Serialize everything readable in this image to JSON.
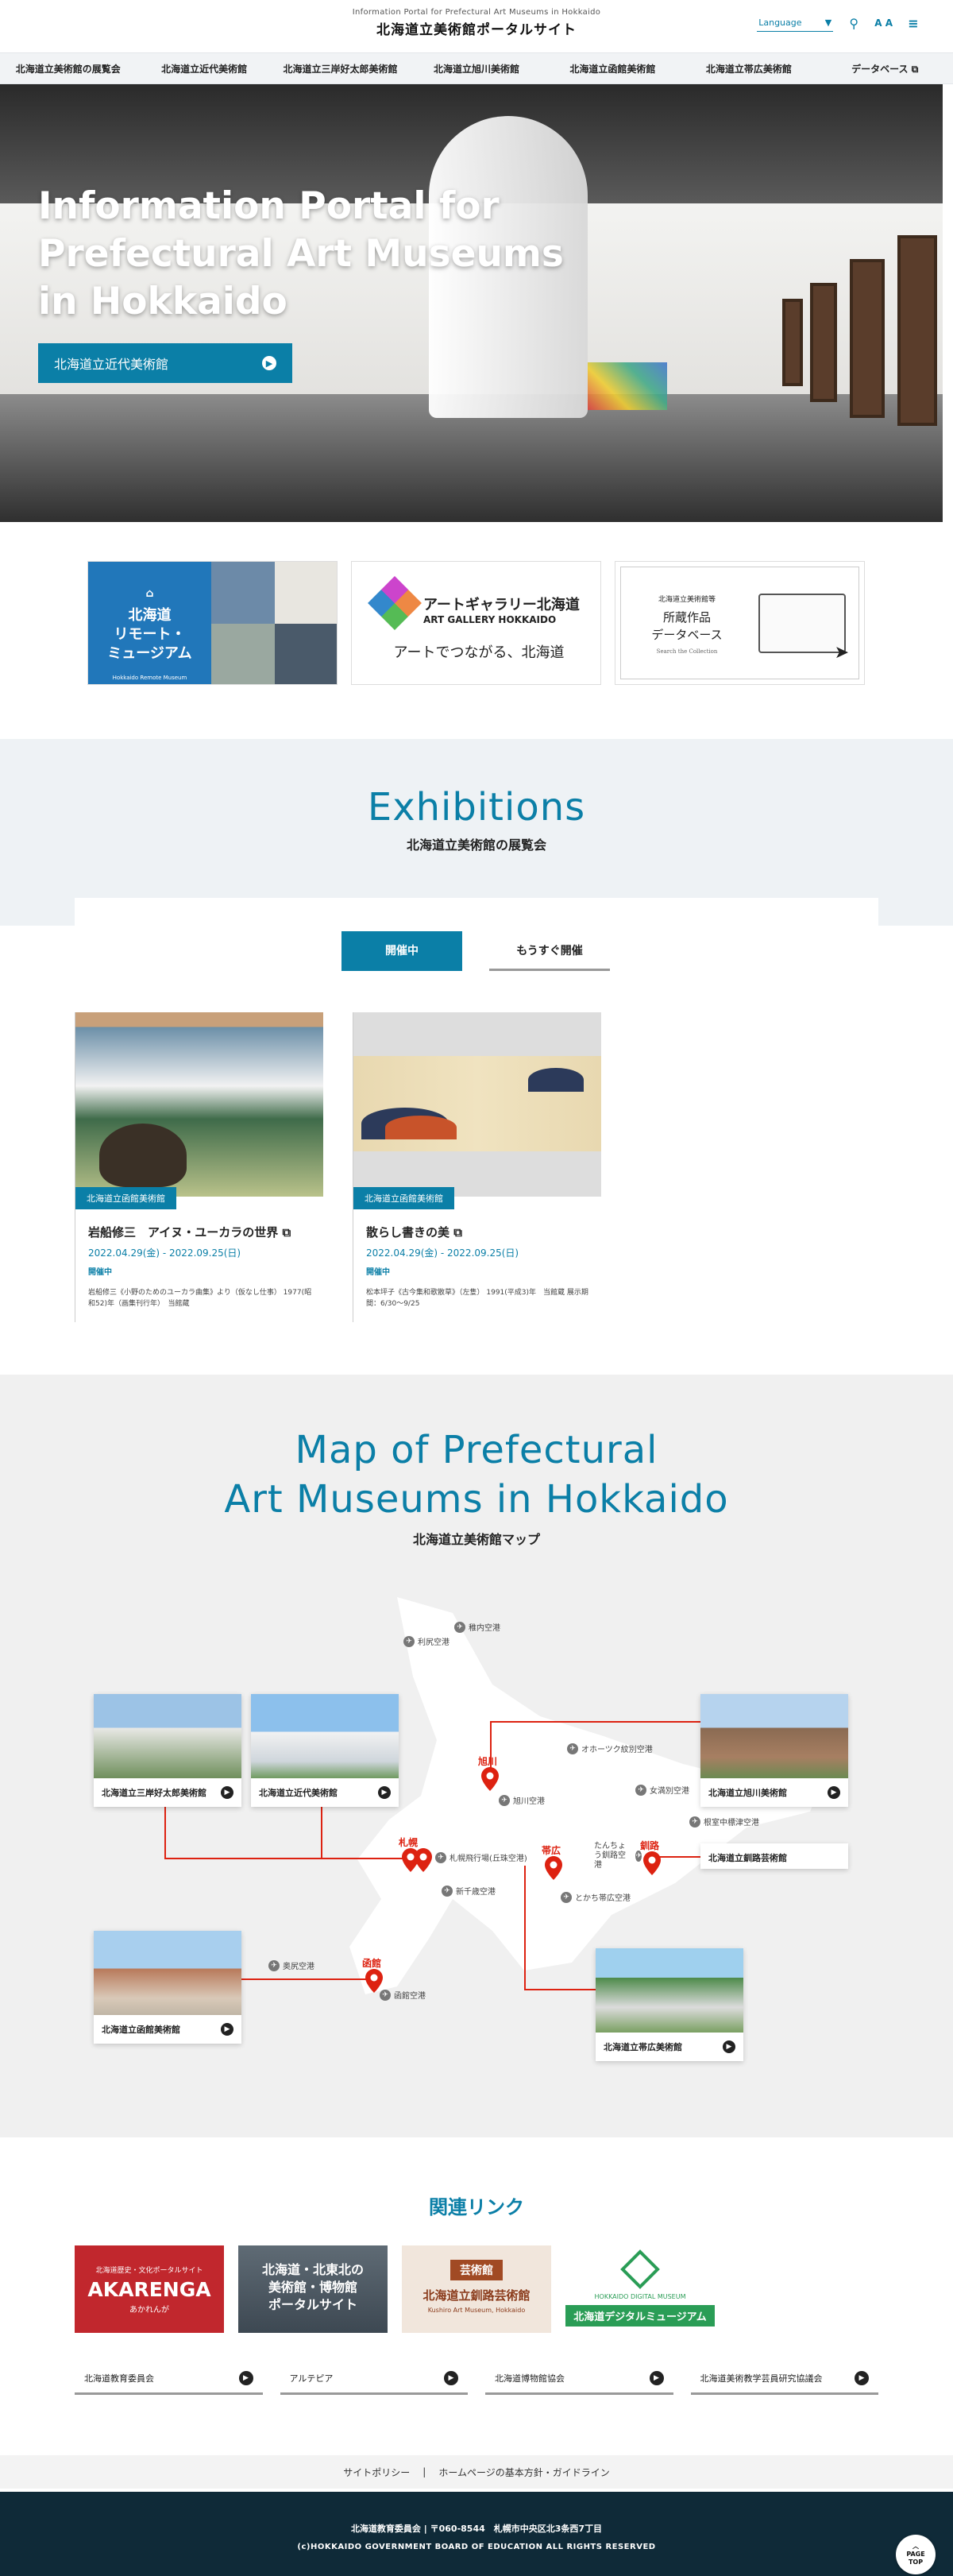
{
  "header": {
    "subtitle_en": "Information Portal for Prefectural Art Museums in Hokkaido",
    "title_ja": "北海道立美術館ポータルサイト",
    "language_label": "Language",
    "search_icon": "search-icon",
    "font_size_label": "A A"
  },
  "nav": [
    {
      "label": "北海道立美術館の展覧会"
    },
    {
      "label": "北海道立近代美術館"
    },
    {
      "label": "北海道立三岸好太郎美術館"
    },
    {
      "label": "北海道立旭川美術館"
    },
    {
      "label": "北海道立函館美術館"
    },
    {
      "label": "北海道立帯広美術館"
    },
    {
      "label": "データベース ⧉"
    }
  ],
  "hero": {
    "title_line1": "Information Portal for",
    "title_line2": "Prefectural Art Museums",
    "title_line3": "in Hokkaido",
    "cta_label": "北海道立近代美術館"
  },
  "banners": {
    "remote": {
      "title_line1": "北海道",
      "title_line2": "リモート・",
      "title_line3": "ミュージアム",
      "sub": "Hokkaido Remote Museum"
    },
    "gallery": {
      "title": "アートギャラリー北海道",
      "title_en": "ART GALLERY HOKKAIDO",
      "tagline": "アートでつながる、北海道"
    },
    "database": {
      "line1": "北海道立美術館等",
      "line2": "所蔵作品",
      "line3": "データベース",
      "line4": "Search the Collection"
    }
  },
  "exhibitions": {
    "title_en": "Exhibitions",
    "title_ja": "北海道立美術館の展覧会",
    "tab_current": "開催中",
    "tab_upcoming": "もうすぐ開催",
    "cards": [
      {
        "museum": "北海道立函館美術館",
        "title": "岩船修三　アイヌ・ユーカラの世界 ⧉",
        "date": "2022.04.29(金) - 2022.09.25(日)",
        "status": "開催中",
        "caption": "岩船修三《小野のためのユーカラ曲集》より（仮なし仕事） 1977(昭和52)年（画集刊行年）　当館蔵"
      },
      {
        "museum": "北海道立函館美術館",
        "title": "散らし書きの美 ⧉",
        "date": "2022.04.29(金) - 2022.09.25(日)",
        "status": "開催中",
        "caption": "松本坪子《古今集和歌散草》（左隻） 1991(平成3)年　当館蔵 展示期間：6/30〜9/25"
      }
    ]
  },
  "map": {
    "title_en_line1": "Map of Prefectural",
    "title_en_line2": "Art Museums in Hokkaido",
    "title_ja": "北海道立美術館マップ",
    "cities": {
      "sapporo": "札幌",
      "asahikawa": "旭川",
      "hakodate": "函館",
      "obihiro": "帯広",
      "kushiro": "釧路"
    },
    "airports": {
      "wakkanai": "稚内空港",
      "rishiri": "利尻空港",
      "okhotsk": "オホーツク紋別空港",
      "asahikawa": "旭川空港",
      "memanbetsu": "女満別空港",
      "nakashibetsu": "根室中標津空港",
      "okadama": "札幌飛行場(丘珠空港)",
      "chitose": "新千歳空港",
      "tokachi": "とかち帯広空港",
      "kushiro": "たんちょう釧路空港",
      "okushiri": "奥尻空港",
      "hakodate": "函館空港"
    },
    "museums": {
      "migishi": "北海道立三岸好太郎美術館",
      "modern": "北海道立近代美術館",
      "asahikawa": "北海道立旭川美術館",
      "kushiro": "北海道立釧路芸術館",
      "hakodate": "北海道立函館美術館",
      "obihiro": "北海道立帯広美術館"
    }
  },
  "related": {
    "title": "関連リンク",
    "akarenga": {
      "sub": "北海道歴史・文化ポータルサイト",
      "main": "AKARENGA",
      "kana": "あかれんが"
    },
    "portal": {
      "line1": "北海道・北東北の",
      "line2": "美術館・博物館",
      "line3": "ポータルサイト"
    },
    "kushiro": {
      "badge": "芸術館",
      "name": "北海道立釧路芸術館",
      "en": "Kushiro Art Museum, Hokkaido"
    },
    "digital": {
      "en": "HOKKAIDO DIGITAL MUSEUM",
      "ja": "北海道デジタルミュージアム"
    },
    "text_links": [
      {
        "label": "北海道教育委員会"
      },
      {
        "label": "アルテピア"
      },
      {
        "label": "北海道博物館協会"
      },
      {
        "label": "北海道美術教学芸員研究協議会"
      }
    ]
  },
  "footer": {
    "policy": "サイトポリシー",
    "sep": "|",
    "guideline": "ホームページの基本方針・ガイドライン",
    "address": "北海道教育委員会 | 〒060-8544　札幌市中央区北3条西7丁目",
    "copyright": "(c)HOKKAIDO GOVERNMENT BOARD OF EDUCATION ALL RIGHTS RESERVED",
    "page_top_line1": "PAGE",
    "page_top_line2": "TOP"
  },
  "colors": {
    "accent": "#0b7fa7",
    "pin": "#dd2211",
    "footer": "#0f2a38",
    "akarenga": "#c1272d",
    "digital": "#2a9d56"
  }
}
